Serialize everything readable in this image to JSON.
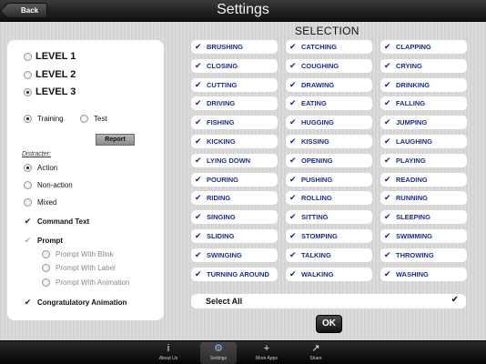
{
  "header": {
    "back_label": "Back",
    "title": "Settings"
  },
  "levels": [
    {
      "label": "LEVEL 1",
      "selected": false
    },
    {
      "label": "LEVEL 2",
      "selected": false
    },
    {
      "label": "LEVEL 3",
      "selected": true
    }
  ],
  "mode": {
    "training_label": "Training",
    "test_label": "Test",
    "selected": "Training"
  },
  "report_label": "Report",
  "distracter": {
    "heading": "Distracter:",
    "options": [
      {
        "label": "Action",
        "selected": true
      },
      {
        "label": "Non-action",
        "selected": false
      },
      {
        "label": "Mixed",
        "selected": false
      }
    ]
  },
  "command_text_label": "Command Text",
  "prompt": {
    "label": "Prompt",
    "options": [
      "Prompt With Blink",
      "Prompt With Label",
      "Prompt With Animation"
    ]
  },
  "congratulatory_label": "Congratulatory Animation",
  "selection": {
    "title": "SELECTION",
    "items": [
      "BRUSHING",
      "CATCHING",
      "CLAPPING",
      "CLOSING",
      "COUGHING",
      "CRYING",
      "CUTTING",
      "DRAWING",
      "DRINKING",
      "DRIVING",
      "EATING",
      "FALLING",
      "FISHING",
      "HUGGING",
      "JUMPING",
      "KICKING",
      "KISSING",
      "LAUGHING",
      "LYING DOWN",
      "OPENING",
      "PLAYING",
      "POURING",
      "PUSHING",
      "READING",
      "RIDING",
      "ROLLING",
      "RUNNING",
      "SINGING",
      "SITTING",
      "SLEEPING",
      "SLIDING",
      "STOMPING",
      "SWIMMING",
      "SWINGING",
      "TALKING",
      "THROWING",
      "TURNING AROUND",
      "WALKING",
      "WASHING"
    ],
    "select_all_label": "Select All"
  },
  "ok_label": "OK",
  "tabs": [
    {
      "label": "About Us",
      "icon": "info-icon",
      "glyph": "i"
    },
    {
      "label": "Settings",
      "icon": "gear-icon",
      "glyph": "⚙"
    },
    {
      "label": "More Apps",
      "icon": "plus-icon",
      "glyph": "+"
    },
    {
      "label": "Share",
      "icon": "share-icon",
      "glyph": "↗"
    }
  ],
  "colors": {
    "item_text": "#1a2f8a",
    "active_tab": "#8fb6ff"
  }
}
